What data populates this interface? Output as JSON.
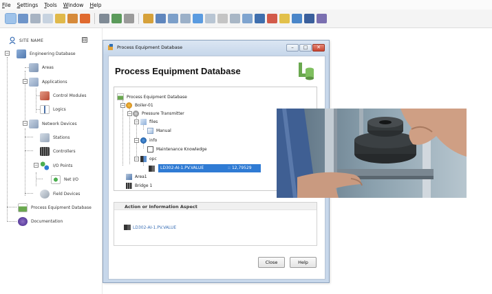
{
  "menu": [
    "File",
    "Settings",
    "Tools",
    "Window",
    "Help"
  ],
  "sidebar": {
    "site_name": "SITE NAME",
    "collapse_symbol": "⊟",
    "items": {
      "engineering_database": "Engineering Database",
      "areas": "Areas",
      "applications": "Applications",
      "control_modules": "Control Modules",
      "logics": "Logics",
      "network_devices": "Network Devices",
      "stations": "Stations",
      "controllers": "Controllers",
      "io_points": "I/O Points",
      "net_io": "Net I/O",
      "field_devices": "Field Devices",
      "process_equipment_database": "Process Equipment Database",
      "documentation": "Documentation"
    }
  },
  "dialog": {
    "window_title": "Process Equipment Database",
    "heading": "Process Equipment Database",
    "tree": {
      "root": "Process Equipment Database",
      "boiler": "Boiler-01",
      "pressure_transmitter": "Pressure Transmitter",
      "files": "files",
      "manual": "Manual",
      "info": "info",
      "maintenance_knowledge": "Maintenance Knowledge",
      "opc": "opc",
      "selected_tag": "LD302-AI-1.PV.VALUE",
      "selected_value": ":: 12,79529",
      "area1": "Area1",
      "bridge1": "Bridge 1"
    },
    "aspect": {
      "header": "Action or Information Aspect",
      "link": "LD302-AI-1.PV.VALUE"
    },
    "buttons": {
      "close": "Close",
      "help": "Help"
    },
    "window_buttons": {
      "minimize": "–",
      "maximize": "□",
      "close": "✕"
    }
  },
  "colors": {
    "selection": "#2f7bd4",
    "link": "#3a6fb5",
    "dialog_frame": "#c7d7ea",
    "close_button": "#c8442f"
  }
}
